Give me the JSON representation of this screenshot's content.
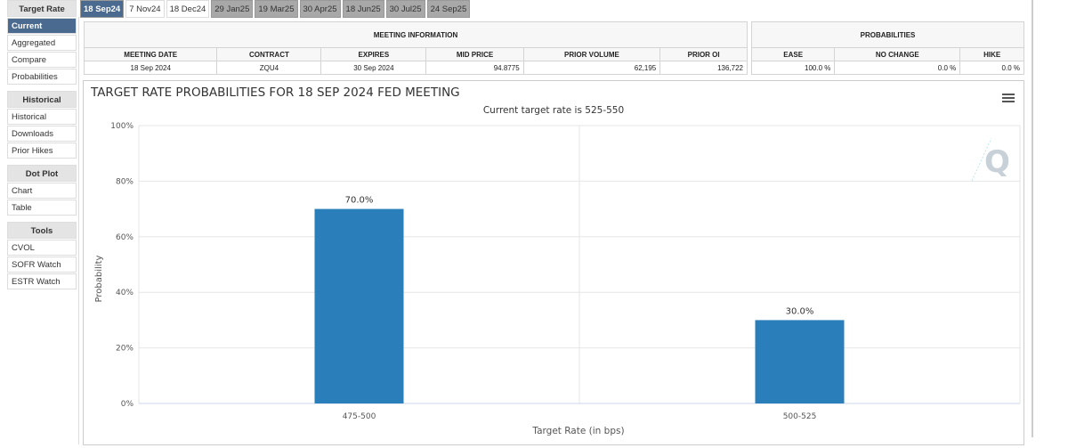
{
  "sidebar": {
    "groups": [
      {
        "title": "Target Rate",
        "items": [
          "Current",
          "Aggregated",
          "Compare",
          "Probabilities"
        ]
      },
      {
        "title": "Historical",
        "items": [
          "Historical",
          "Downloads",
          "Prior Hikes"
        ]
      },
      {
        "title": "Dot Plot",
        "items": [
          "Chart",
          "Table"
        ]
      },
      {
        "title": "Tools",
        "items": [
          "CVOL",
          "SOFR Watch",
          "ESTR Watch"
        ]
      }
    ],
    "active": "Current"
  },
  "tabs": [
    "18 Sep24",
    "7 Nov24",
    "18 Dec24",
    "29 Jan25",
    "19 Mar25",
    "30 Apr25",
    "18 Jun25",
    "30 Jul25",
    "24 Sep25"
  ],
  "meeting_info": {
    "title": "MEETING INFORMATION",
    "headers": [
      "MEETING DATE",
      "CONTRACT",
      "EXPIRES",
      "MID PRICE",
      "PRIOR VOLUME",
      "PRIOR OI"
    ],
    "values": [
      "18 Sep 2024",
      "ZQU4",
      "30 Sep 2024",
      "94.8775",
      "62,195",
      "136,722"
    ]
  },
  "probabilities": {
    "title": "PROBABILITIES",
    "headers": [
      "EASE",
      "NO CHANGE",
      "HIKE"
    ],
    "values": [
      "100.0 %",
      "0.0 %",
      "0.0 %"
    ]
  },
  "chart_data": {
    "type": "bar",
    "title": "TARGET RATE PROBABILITIES FOR 18 SEP 2024 FED MEETING",
    "subtitle": "Current target rate is 525-550",
    "categories": [
      "475-500",
      "500-525"
    ],
    "values": [
      70.0,
      30.0
    ],
    "data_labels": [
      "70.0%",
      "30.0%"
    ],
    "xlabel": "Target Rate (in bps)",
    "ylabel": "Probability",
    "ylim": [
      0,
      100
    ],
    "yticks": [
      "0%",
      "20%",
      "40%",
      "60%",
      "80%",
      "100%"
    ],
    "grid": true,
    "color": "#2a7fba"
  }
}
